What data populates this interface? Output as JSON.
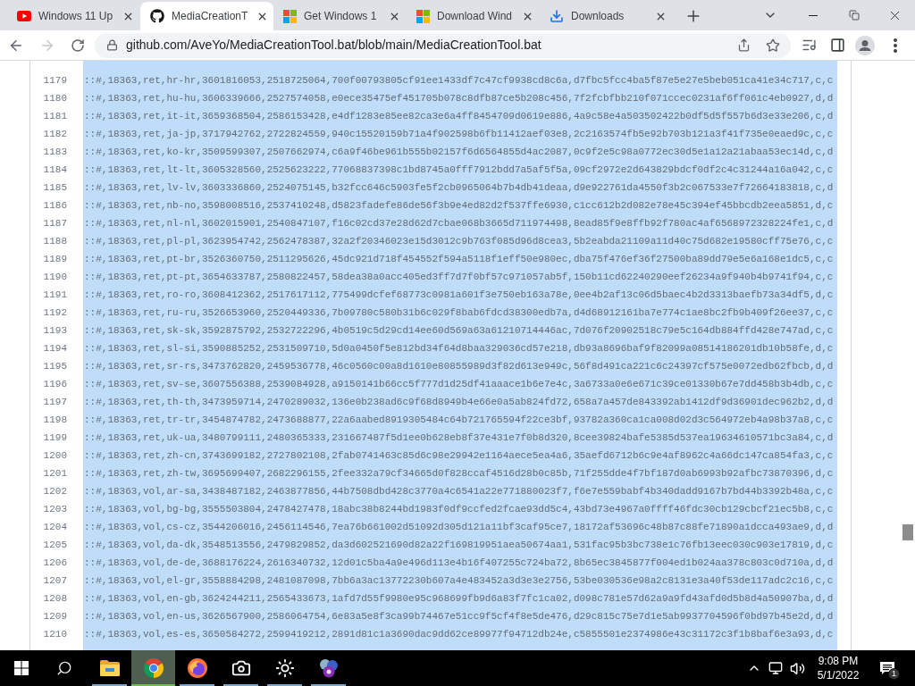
{
  "browser": {
    "tabs": [
      {
        "kind": "video",
        "title": "Windows 11 Up",
        "selected": false
      },
      {
        "kind": "code",
        "title": "MediaCreationT",
        "selected": true
      },
      {
        "kind": "windows",
        "title": "Get Windows 1",
        "selected": false
      },
      {
        "kind": "windows",
        "title": "Download Wind",
        "selected": false
      },
      {
        "kind": "download",
        "title": "Downloads",
        "selected": false
      }
    ],
    "toolbar": {
      "back": {
        "disabled": false
      },
      "forward": {
        "disabled": true
      },
      "url": "github.com/AveYo/MediaCreationTool.bat/blob/main/MediaCreationTool.bat"
    }
  },
  "code": {
    "selected": true,
    "lines": [
      {
        "number": "1179",
        "text": "::#,18363,ret,hr-hr,3601816053,2518725064,700f00793805cf91ee1433df7c47cf9938cd8c6a,d7fbc5fcc4ba5f87e5e27e5beb051ca41e34c717,c,c"
      },
      {
        "number": "1180",
        "text": "::#,18363,ret,hu-hu,3606339666,2527574058,e0ece35475ef451705b078c8dfb87ce5b208c456,7f2fcbfbb210f071ccec0231af6ff061c4eb0927,d,d"
      },
      {
        "number": "1181",
        "text": "::#,18363,ret,it-it,3659368504,2586153428,e4df1283e85ee82ca3e6a4ff8454709d0619e886,4a9c58e4a503502422b0df5d5f557b6d3e33e206,c,d"
      },
      {
        "number": "1182",
        "text": "::#,18363,ret,ja-jp,3717942762,2722824559,940c15520159b71a4f902598b6fb11412aef03e8,2c2163574fb5e92b703b121a3f41f735e0eaed9c,c,c"
      },
      {
        "number": "1183",
        "text": "::#,18363,ret,ko-kr,3509599307,2507662974,c6a9f46be961b555b02157f6d6564855d4ac2087,0c9f2e5c98a0772ec30d5e1a12a21abaa53ec14d,c,d"
      },
      {
        "number": "1184",
        "text": "::#,18363,ret,lt-lt,3605328560,2525623222,77068837398c1bd8745a0fff7912bdd7a5af5f5a,09cf2972e2d643829bdcf0df2c4c31244a16a042,c,c"
      },
      {
        "number": "1185",
        "text": "::#,18363,ret,lv-lv,3603336860,2524075145,b32fcc646c5903fe5f2cb0965064b7b4db41deaa,d9e922761da4550f3b2c067533e7f72664183818,c,d"
      },
      {
        "number": "1186",
        "text": "::#,18363,ret,nb-no,3598008516,2537410248,d5823fadefe86de56f3b9e4ed82d2f537ffe6930,c1cc612b2d082e78e45c394ef45bbcdb2eea5851,d,c"
      },
      {
        "number": "1187",
        "text": "::#,18363,ret,nl-nl,3602015901,2540847107,f16c02cd37e28d62d7cbae068b3665d711974498,8ead85f9e8ffb92f780ac4af6568972328224fe1,c,d"
      },
      {
        "number": "1188",
        "text": "::#,18363,ret,pl-pl,3623954742,2562478387,32a2f20346023e15d3012c9b763f085d96d8cea3,5b2eabda21109a11d40c75d682e19580cff75e76,c,c"
      },
      {
        "number": "1189",
        "text": "::#,18363,ret,pt-br,3526360750,2511295626,45dc921d718f454552f594a5118f1eff50e980ec,dba75f476ef36f27500ba89dd79e5e6a168e1dc5,c,c"
      },
      {
        "number": "1190",
        "text": "::#,18363,ret,pt-pt,3654633787,2580822457,58dea38a0acc405ed3ff7d7f0bf57c971057ab5f,150b11cd62240290eef26234a9f940b4b9741f94,c,c"
      },
      {
        "number": "1191",
        "text": "::#,18363,ret,ro-ro,3608412362,2517617112,775499dcfef68773c0981a601f3e750eb163a78e,0ee4b2af13c06d5baec4b2d3313baefb73a34df5,d,c"
      },
      {
        "number": "1192",
        "text": "::#,18363,ret,ru-ru,3526653960,2520449336,7b09780c580b31b6c029f8bab6fdcd38300edb7a,d4d68912161ba7e774c1ae8bc2fb9b409f26ee37,c,c"
      },
      {
        "number": "1193",
        "text": "::#,18363,ret,sk-sk,3592875792,2532722296,4b0519c5d29cd14ee60d569a63a61210714446ac,7d076f20902518c79e5c164db884ffd428e747ad,c,c"
      },
      {
        "number": "1194",
        "text": "::#,18363,ret,sl-si,3590885252,2531509710,5d0a0450f5e812bd34f64d8baa329036cd57e218,db93a8696baf9f82099a08514186201db10b58fe,d,c"
      },
      {
        "number": "1195",
        "text": "::#,18363,ret,sr-rs,3473762820,2459536778,46c0560c00a8d1610e80855989d3f82d613e949c,56f8d491ca221c6c24397cf575e0072edb62fbcb,d,d"
      },
      {
        "number": "1196",
        "text": "::#,18363,ret,sv-se,3607556388,2539084928,a9150141b66cc5f777d1d25df41aaace1b6e7e4c,3a6733a0e6e671c39ce01330b67e7dd458b3b4db,c,c"
      },
      {
        "number": "1197",
        "text": "::#,18363,ret,th-th,3473959714,2470289032,136e0b238ad6c9f68d8949b4e66e0a5ab824fd72,658a7a457de843392ab1412df9d36901dec962b2,d,d"
      },
      {
        "number": "1198",
        "text": "::#,18363,ret,tr-tr,3454874782,2473688877,22a6aabed8919305484c64b721765594f22ce3bf,93782a360ca1ca008d02d3c564972eb4a98b37a8,c,c"
      },
      {
        "number": "1199",
        "text": "::#,18363,ret,uk-ua,3480799111,2480365333,231667487f5d1ee0b628eb8f37e431e7f0b8d320,8cee39824bafe5385d537ea19634610571bc3a84,c,d"
      },
      {
        "number": "1200",
        "text": "::#,18363,ret,zh-cn,3743699182,2727802108,2fab0741463c85d6c98e29942e1164aece5ea4a6,35aefd6712b6c9e4af8962c4a66dc147ca854fa3,c,c"
      },
      {
        "number": "1201",
        "text": "::#,18363,ret,zh-tw,3695699407,2682296155,2fee332a79cf34665d0f828ccaf4516d28b0c85b,71f255dde4f7bf187d0ab6993b92afbc73870396,d,c"
      },
      {
        "number": "1202",
        "text": "::#,18363,vol,ar-sa,3438487182,2463877856,44b7508dbd428c3770a4c6541a22e771880023f7,f6e7e559babf4b340dadd9167b7bd44b3392b48a,c,c"
      },
      {
        "number": "1203",
        "text": "::#,18363,vol,bg-bg,3555503804,2478427478,18abc38b8244bd1983f0df9ccfed2fcae93dd5c4,43bd73e4967a0ffff46fdc30cb129cbcf21ec5b8,c,c"
      },
      {
        "number": "1204",
        "text": "::#,18363,vol,cs-cz,3544206016,2456114546,7ea76b661002d51092d305d121a11bf3caf95ce7,18172af53696c48b87c88fe71890a1dcca493ae9,d,d"
      },
      {
        "number": "1205",
        "text": "::#,18363,vol,da-dk,3548513556,2479829852,da3d602521690d82a22f169819951aea50674aa1,531fac95b3bc738e1c76fb13eec030c903e17819,d,c"
      },
      {
        "number": "1206",
        "text": "::#,18363,vol,de-de,3688176224,2616340732,12d01c5ba4a9e496d113e4b16f407255c724ba72,8b65ec3845877f004ed1b024aa378c803c0d710a,d,d"
      },
      {
        "number": "1207",
        "text": "::#,18363,vol,el-gr,3558884298,2481087098,7bb6a3ac13772230b607a4e483452a3d3e3e2756,53be030536e98a2c8131e3a40f53de117adc2c16,c,c"
      },
      {
        "number": "1208",
        "text": "::#,18363,vol,en-gb,3624244211,2565433673,1afd7d55f9980e95c968699fb9d6a83f7fc1ca02,d098c781e57d62a9a9fd43afd0d5b8d4a50907ba,d,d"
      },
      {
        "number": "1209",
        "text": "::#,18363,vol,en-us,3626567900,2586064754,6e83a5e8f3ca99b74467e51cc9f5cf4f8e5de476,d29c815c75e7d1e5ab9937704596f0bd97b45e2d,d,d"
      },
      {
        "number": "1210",
        "text": "::#,18363,vol,es-es,3650584272,2599419212,2891d81c1a3690dac9dd62ce89977f94712db24e,c5855501e2374986e43c31172c3f1b8baf6e3a93,d,c"
      }
    ]
  },
  "taskbar": {
    "apps": [
      {
        "kind": "files",
        "active": false,
        "running": true
      },
      {
        "kind": "chrome",
        "active": true,
        "running": true
      },
      {
        "kind": "firefox",
        "active": false,
        "running": true
      },
      {
        "kind": "camera",
        "active": false,
        "running": true
      },
      {
        "kind": "brightness",
        "active": false,
        "running": true
      },
      {
        "kind": "spheres",
        "active": false,
        "running": true
      }
    ],
    "clock": {
      "time": "9:08 PM",
      "date": "5/1/2022"
    },
    "notifications": {
      "count": "1"
    }
  }
}
